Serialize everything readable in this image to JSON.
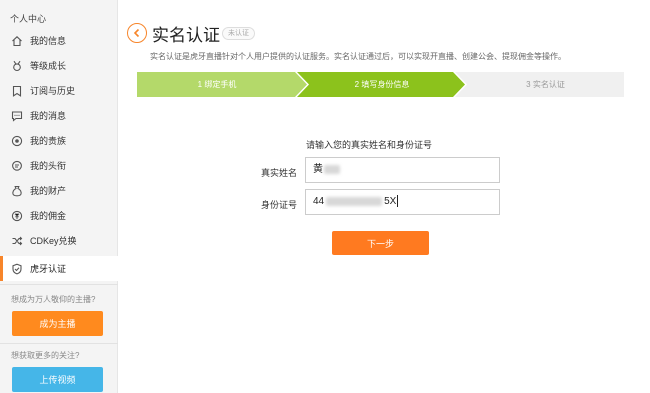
{
  "sidebar": {
    "title": "个人中心",
    "items": [
      {
        "label": "我的信息",
        "icon": "home-icon"
      },
      {
        "label": "等级成长",
        "icon": "medal-icon"
      },
      {
        "label": "订阅与历史",
        "icon": "bookmark-icon"
      },
      {
        "label": "我的消息",
        "icon": "message-icon"
      },
      {
        "label": "我的贵族",
        "icon": "target-icon"
      },
      {
        "label": "我的头衔",
        "icon": "chat-icon"
      },
      {
        "label": "我的财产",
        "icon": "moneybag-icon"
      },
      {
        "label": "我的佣金",
        "icon": "coin-icon"
      },
      {
        "label": "CDKey兑换",
        "icon": "shuffle-icon"
      },
      {
        "label": "虎牙认证",
        "icon": "shield-check-icon"
      }
    ],
    "active_index": 9,
    "streamer_hint": "想成为万人敬仰的主播?",
    "streamer_button": "成为主播",
    "video_hint": "想获取更多的关注?",
    "video_button": "上传视频"
  },
  "main": {
    "title": "实名认证",
    "status_badge": "未认证",
    "description": "实名认证是虎牙直播针对个人用户提供的认证服务。实名认证通过后，可以实现开直播、创建公会、提现佣金等操作。",
    "steps": [
      {
        "label": "1 绑定手机",
        "state": "done"
      },
      {
        "label": "2 填写身份信息",
        "state": "current"
      },
      {
        "label": "3 实名认证",
        "state": "pending"
      }
    ],
    "form": {
      "heading": "请输入您的真实姓名和身份证号",
      "name_label": "真实姓名",
      "name_value_visible": "黄",
      "id_label": "身份证号",
      "id_value_start": "44",
      "id_value_end": "5X",
      "submit": "下一步"
    }
  },
  "colors": {
    "accent_orange": "#ff7a20",
    "step_done": "#b4d96a",
    "step_current": "#8cc21c",
    "step_pending": "#f0f0f0",
    "blue": "#45b6e8"
  }
}
